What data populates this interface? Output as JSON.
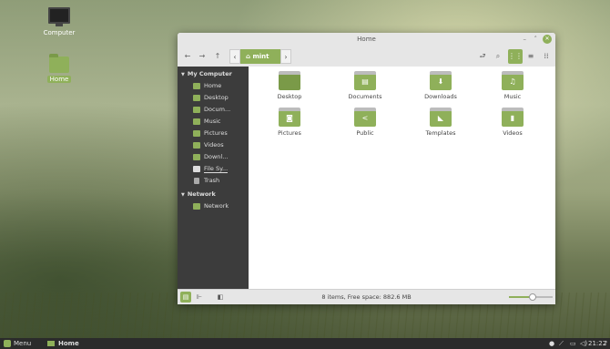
{
  "desktop": {
    "icons": [
      {
        "label": "Computer",
        "icon": "computer-icon"
      },
      {
        "label": "Home",
        "icon": "home-folder-icon",
        "selected": true
      }
    ]
  },
  "window": {
    "title": "Home",
    "controls": {
      "minimize": "–",
      "maximize": "˄",
      "close": "✕"
    },
    "toolbar": {
      "back": "←",
      "forward": "→",
      "up": "↑",
      "crumb_prev": "‹",
      "crumb_current": "mint",
      "crumb_next": "›",
      "toggle_location": "⮐",
      "search": "⌕",
      "view_icons": "⋮⋮",
      "view_list": "≡",
      "view_compact": "⁞⁞"
    },
    "sidebar": {
      "sections": [
        {
          "title": "My Computer",
          "items": [
            {
              "label": "Home",
              "icon": "home-icon"
            },
            {
              "label": "Desktop",
              "icon": "desktop-folder-icon"
            },
            {
              "label": "Docum...",
              "icon": "documents-folder-icon"
            },
            {
              "label": "Music",
              "icon": "music-folder-icon"
            },
            {
              "label": "Pictures",
              "icon": "pictures-folder-icon"
            },
            {
              "label": "Videos",
              "icon": "videos-folder-icon"
            },
            {
              "label": "Downl...",
              "icon": "downloads-folder-icon"
            },
            {
              "label": "File Sy...",
              "icon": "drive-icon"
            },
            {
              "label": "Trash",
              "icon": "trash-icon"
            }
          ]
        },
        {
          "title": "Network",
          "items": [
            {
              "label": "Network",
              "icon": "network-icon"
            }
          ]
        }
      ]
    },
    "files": [
      {
        "label": "Desktop",
        "icon": "desktop-folder-icon",
        "glyph": ""
      },
      {
        "label": "Documents",
        "icon": "documents-folder-icon",
        "glyph": "▤"
      },
      {
        "label": "Downloads",
        "icon": "downloads-folder-icon",
        "glyph": "⬇"
      },
      {
        "label": "Music",
        "icon": "music-folder-icon",
        "glyph": "♫"
      },
      {
        "label": "Pictures",
        "icon": "pictures-folder-icon",
        "glyph": "◙"
      },
      {
        "label": "Public",
        "icon": "public-folder-icon",
        "glyph": "<"
      },
      {
        "label": "Templates",
        "icon": "templates-folder-icon",
        "glyph": "◣"
      },
      {
        "label": "Videos",
        "icon": "videos-folder-icon",
        "glyph": "▮"
      }
    ],
    "statusbar": {
      "text": "8 items, Free space: 882.6 MB",
      "places_btn": "▤",
      "tree_btn": "⊩",
      "toggle_sidebar_btn": "◧",
      "zoom_level": 0.55
    }
  },
  "panel": {
    "menu_label": "Menu",
    "task_label": "Home",
    "tray": {
      "user": "●",
      "network": "⟋",
      "power": "▭",
      "sound": "◁)",
      "music": "♪"
    },
    "clock": "21:22"
  },
  "colors": {
    "accent": "#8fb05a",
    "sidebar_bg": "#3c3c3c",
    "panel_bg": "#2b2b2b"
  }
}
